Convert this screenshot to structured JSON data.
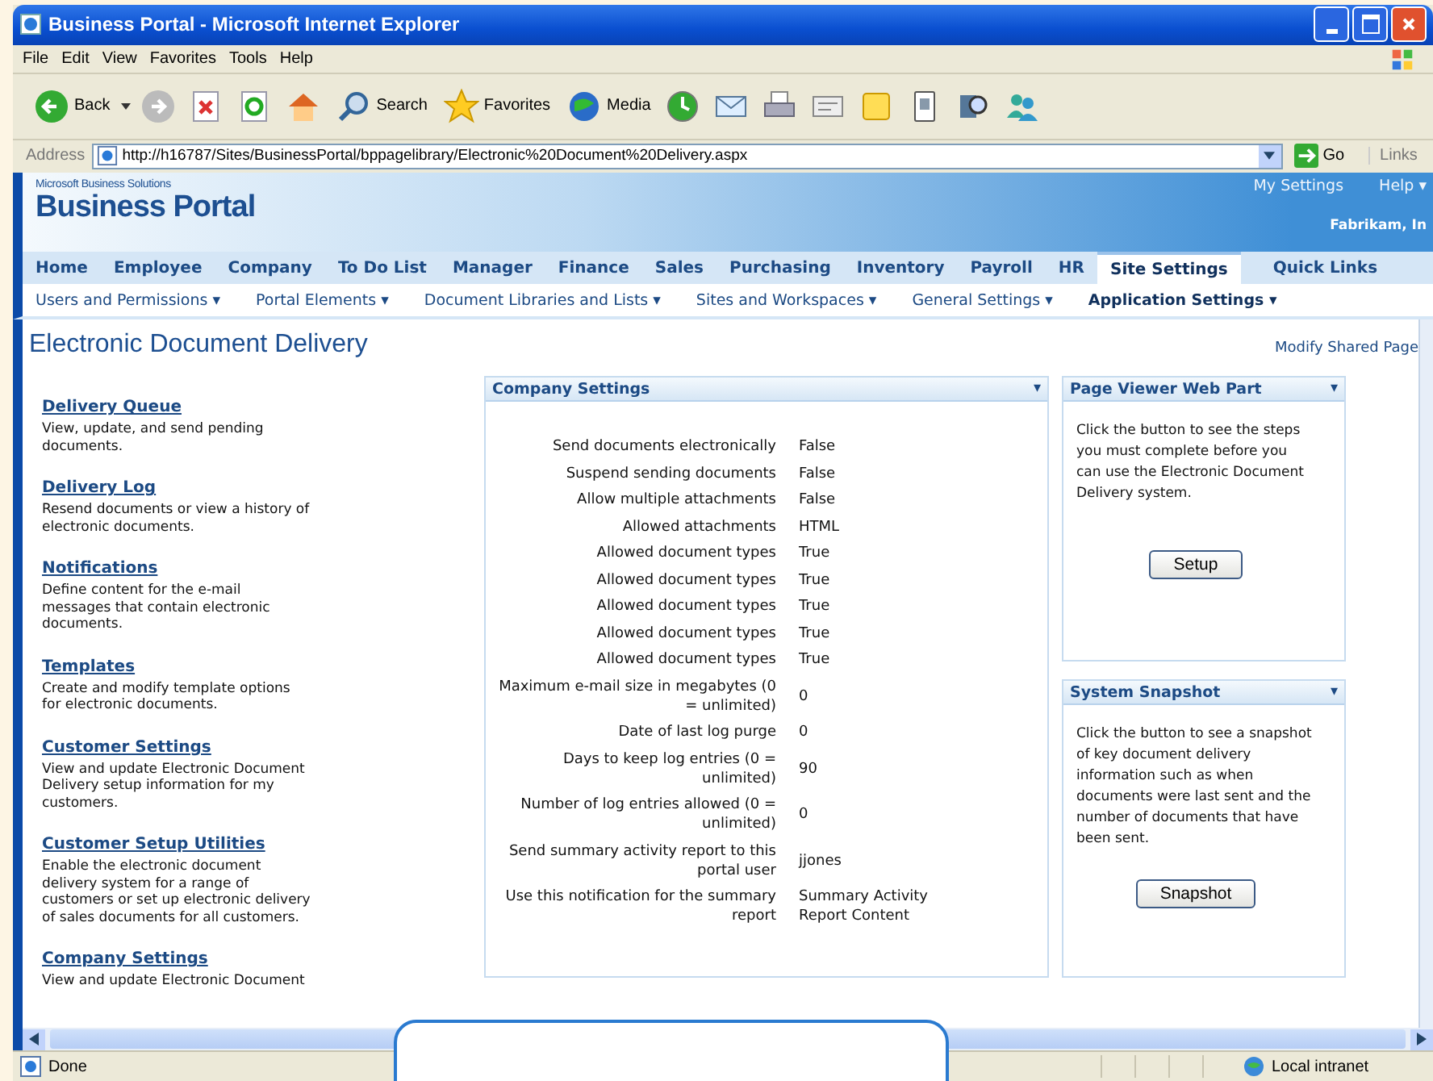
{
  "window": {
    "title": "Business Portal - Microsoft Internet Explorer"
  },
  "menu": [
    "File",
    "Edit",
    "View",
    "Favorites",
    "Tools",
    "Help"
  ],
  "toolbar": {
    "back": "Back",
    "search": "Search",
    "favorites": "Favorites",
    "media": "Media"
  },
  "address": {
    "label": "Address",
    "value": "http://h16787/Sites/BusinessPortal/bppagelibrary/Electronic%20Document%20Delivery.aspx",
    "go": "Go",
    "links": "Links"
  },
  "banner": {
    "brand_small": "Microsoft Business Solutions",
    "brand": "Business Portal",
    "my_settings": "My Settings",
    "help": "Help ▾",
    "company": "Fabrikam, In"
  },
  "tabs": [
    {
      "label": "Home",
      "selected": false
    },
    {
      "label": "Employee",
      "selected": false
    },
    {
      "label": "Company",
      "selected": false
    },
    {
      "label": "To Do List",
      "selected": false
    },
    {
      "label": "Manager",
      "selected": false
    },
    {
      "label": "Finance",
      "selected": false
    },
    {
      "label": "Sales",
      "selected": false
    },
    {
      "label": "Purchasing",
      "selected": false
    },
    {
      "label": "Inventory",
      "selected": false
    },
    {
      "label": "Payroll",
      "selected": false
    },
    {
      "label": "HR",
      "selected": false
    },
    {
      "label": "Site Settings",
      "selected": true
    },
    {
      "label": "Quick Links",
      "selected": false
    }
  ],
  "subnav": [
    {
      "label": "Users and Permissions ▾",
      "selected": false
    },
    {
      "label": "Portal Elements ▾",
      "selected": false
    },
    {
      "label": "Document Libraries and Lists ▾",
      "selected": false
    },
    {
      "label": "Sites and Workspaces ▾",
      "selected": false
    },
    {
      "label": "General Settings ▾",
      "selected": false
    },
    {
      "label": "Application Settings ▾",
      "selected": true
    }
  ],
  "page": {
    "title": "Electronic Document Delivery",
    "modify": "Modify Shared Page"
  },
  "sections": [
    {
      "title": "Delivery Queue",
      "description": "View, update, and send pending documents."
    },
    {
      "title": "Delivery Log",
      "description": "Resend documents or view a history of electronic documents."
    },
    {
      "title": "Notifications",
      "description": "Define content for the e-mail messages that contain electronic documents."
    },
    {
      "title": "Templates",
      "description": "Create and modify template options for electronic documents."
    },
    {
      "title": "Customer Settings",
      "description": "View and update Electronic Document Delivery setup information for my customers."
    },
    {
      "title": "Customer Setup Utilities",
      "description": "Enable the electronic document delivery system for a range of customers or set up electronic delivery of sales documents for all customers."
    },
    {
      "title": "Company Settings",
      "description": "View and update Electronic Document"
    }
  ],
  "company_settings": {
    "title": "Company Settings",
    "menu": "▾",
    "rows": [
      {
        "label": "Send documents electronically",
        "value": "False"
      },
      {
        "label": "Suspend sending documents",
        "value": "False"
      },
      {
        "label": "Allow multiple attachments",
        "value": "False"
      },
      {
        "label": "Allowed attachments",
        "value": "HTML"
      },
      {
        "label": "Allowed document types",
        "value": "True"
      },
      {
        "label": "Allowed document types",
        "value": "True"
      },
      {
        "label": "Allowed document types",
        "value": "True"
      },
      {
        "label": "Allowed document types",
        "value": "True"
      },
      {
        "label": "Allowed document types",
        "value": "True"
      },
      {
        "label": "Maximum e-mail size in megabytes (0 = unlimited)",
        "value": "0"
      },
      {
        "label": "Date of last log purge",
        "value": "0"
      },
      {
        "label": "Days to keep log entries (0 = unlimited)",
        "value": "90"
      },
      {
        "label": "Number of log entries allowed (0 = unlimited)",
        "value": "0"
      },
      {
        "label": "Send summary activity report to this portal user",
        "value": "jjones"
      },
      {
        "label": "Use this notification for the summary report",
        "value": "Summary Activity Report Content"
      }
    ]
  },
  "side_panels": [
    {
      "title": "Page Viewer Web Part",
      "menu": "▾",
      "text": "Click the button to see the steps you must complete before you can use the Electronic Document Delivery system.",
      "button": "Setup"
    },
    {
      "title": "System Snapshot",
      "menu": "▾",
      "text": "Click the button to see a snapshot of key document delivery information such as when documents were last sent and the number of documents that have been sent.",
      "button": "Snapshot"
    }
  ],
  "status_bar": {
    "text": "Done",
    "zone": "Local intranet"
  }
}
